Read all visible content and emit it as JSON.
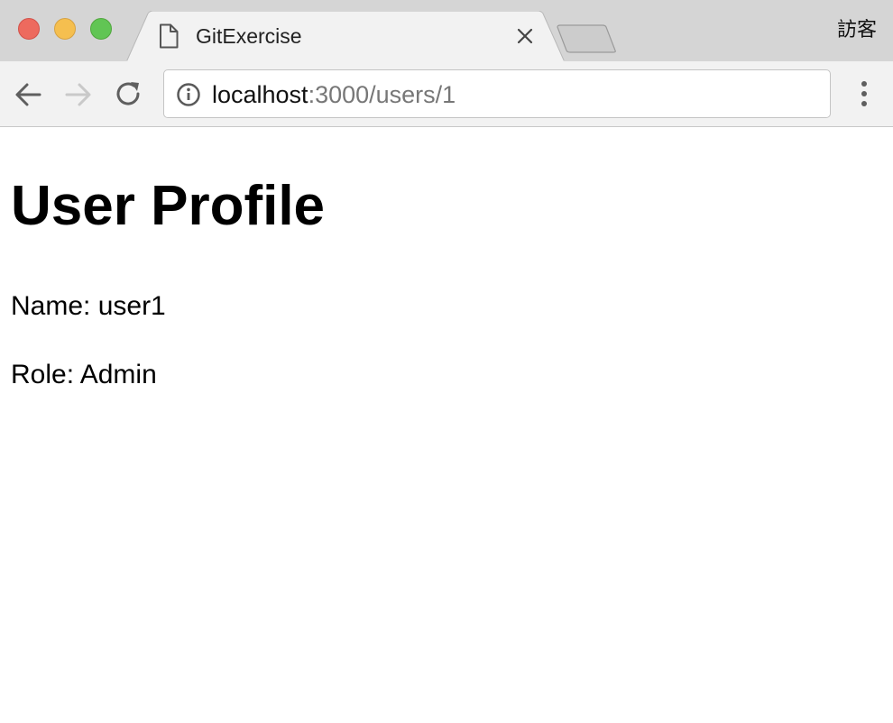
{
  "browser": {
    "tab": {
      "title": "GitExercise",
      "page_icon": "page-icon",
      "close_icon": "close-icon"
    },
    "new_tab_icon": "new-tab-icon",
    "profile_label": "訪客",
    "toolbar": {
      "back_icon": "back-arrow-icon",
      "forward_icon": "forward-arrow-icon",
      "reload_icon": "reload-icon",
      "menu_icon": "kebab-menu-icon"
    },
    "address": {
      "info_icon": "info-icon",
      "host": "localhost",
      "path": ":3000/users/1"
    }
  },
  "page": {
    "heading": "User Profile",
    "name_line": "Name: user1",
    "role_line": "Role: Admin"
  },
  "colors": {
    "tab_strip": "#d5d5d5",
    "toolbar": "#f2f2f2",
    "close_red": "#ed6a5e",
    "minimize_yellow": "#f5bf4f",
    "zoom_green": "#61c554",
    "url_path_gray": "#777777"
  }
}
